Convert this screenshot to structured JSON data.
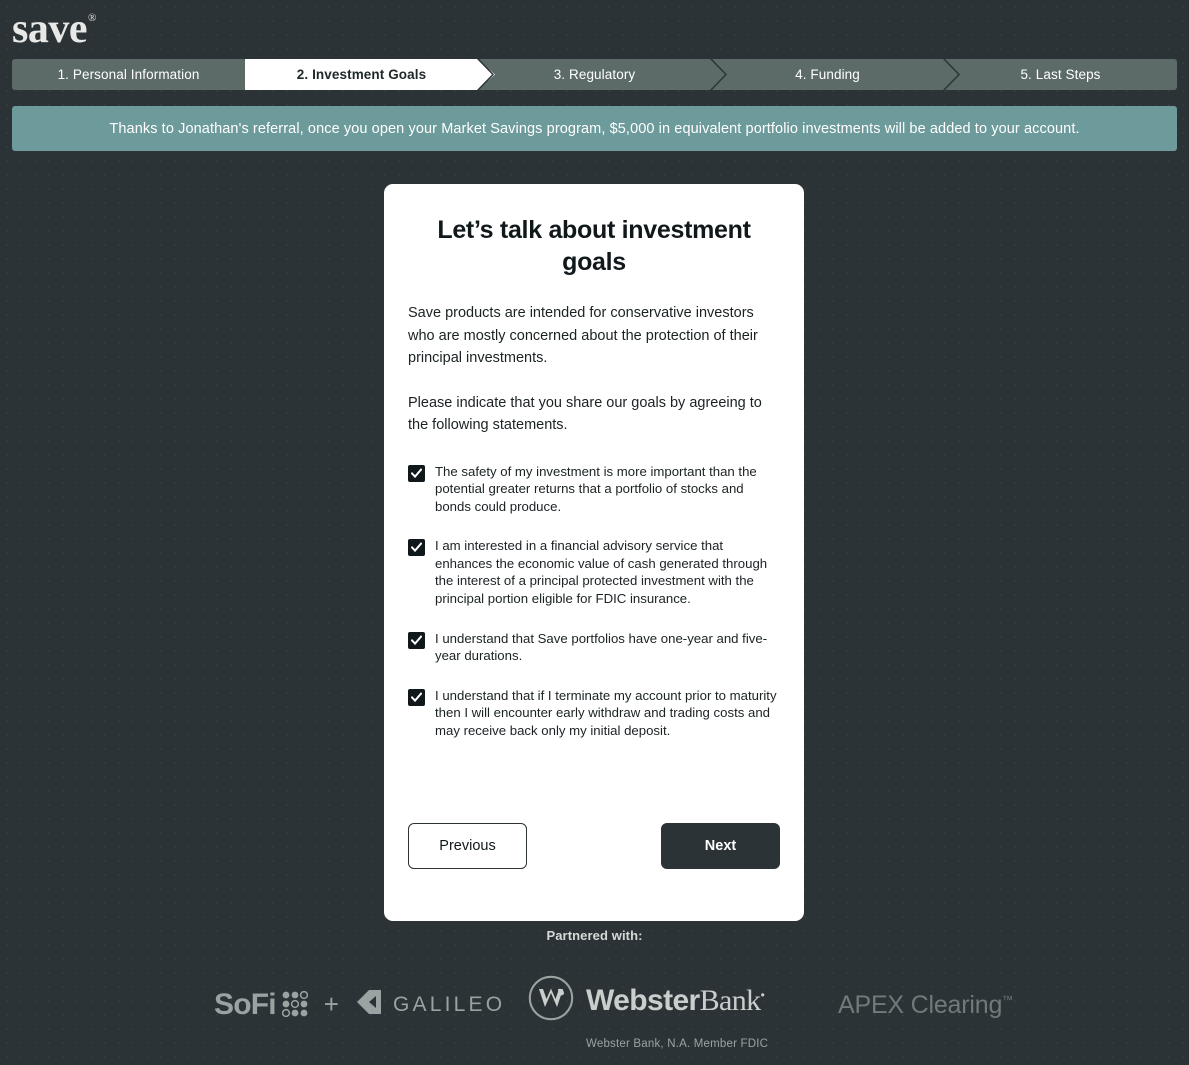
{
  "brand": {
    "logo_text": "save",
    "logo_trademark": "®"
  },
  "steps": [
    {
      "label": "1. Personal Information",
      "active": false
    },
    {
      "label": "2. Investment Goals",
      "active": true
    },
    {
      "label": "3. Regulatory",
      "active": false
    },
    {
      "label": "4. Funding",
      "active": false
    },
    {
      "label": "5. Last Steps",
      "active": false
    }
  ],
  "banner": {
    "message": "Thanks to Jonathan's referral, once you open your Market Savings program, $5,000 in equivalent portfolio investments will be added to your account.",
    "background_color": "#6d9a9b"
  },
  "card": {
    "title": "Let’s talk about investment goals",
    "paragraph_1": "Save products are intended for conservative investors who are mostly concerned about the protection of their principal investments.",
    "paragraph_2": "Please indicate that you share our goals by agreeing to the following statements.",
    "statements": [
      {
        "checked": true,
        "text": "The safety of my investment is more important than the potential greater returns that a portfolio of stocks and bonds could produce."
      },
      {
        "checked": true,
        "text": "I am interested in a financial advisory service that enhances the economic value of cash generated through the interest of a principal protected investment with the principal portion eligible for FDIC insurance."
      },
      {
        "checked": true,
        "text": "I understand that Save portfolios have one-year and five-year durations."
      },
      {
        "checked": true,
        "text": "I understand that if I terminate my account prior to maturity then I will encounter early withdraw and trading costs and may receive back only my initial deposit."
      }
    ],
    "previous_label": "Previous",
    "next_label": "Next"
  },
  "footer": {
    "partnered_label": "Partnered with:",
    "sofi_label": "SoFi",
    "plus_label": "+",
    "galileo_label": "GALILEO",
    "webster_label_bold": "Webster",
    "webster_label_light": "Bank",
    "webster_trademark": "•",
    "webster_disclaimer": "Webster Bank, N.A.  Member FDIC",
    "apex_label": "APEX Clearing",
    "apex_trademark": "™"
  },
  "theme": {
    "background": "#2b3336",
    "step_inactive": "#5c6a68",
    "step_active": "#ffffff",
    "card_background": "#ffffff",
    "accent_dark": "#11181b"
  }
}
